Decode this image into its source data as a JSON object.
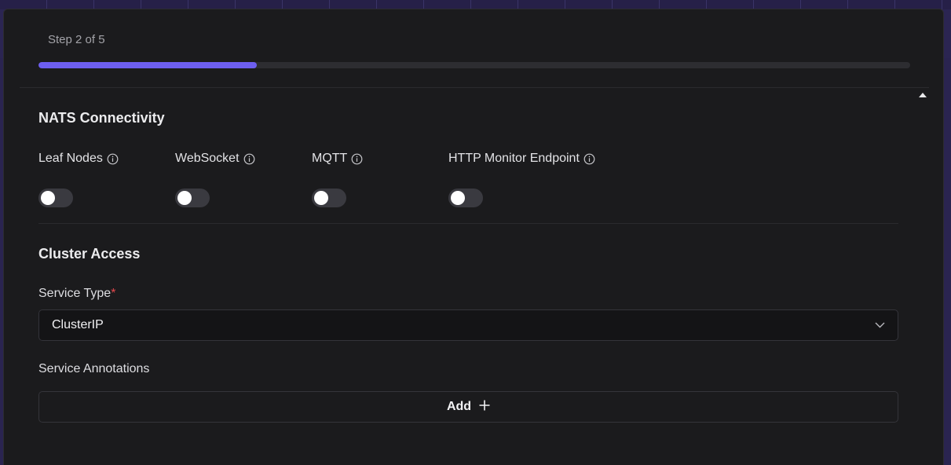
{
  "stepper": {
    "label": "Step 2 of 5",
    "progress_fraction": 0.25,
    "accent_color": "#6d5ef0"
  },
  "nats_connectivity": {
    "title": "NATS Connectivity",
    "toggles": [
      {
        "label": "Leaf Nodes",
        "enabled": false,
        "icon": "info-icon"
      },
      {
        "label": "WebSocket",
        "enabled": false,
        "icon": "info-icon"
      },
      {
        "label": "MQTT",
        "enabled": false,
        "icon": "info-icon"
      },
      {
        "label": "HTTP Monitor Endpoint",
        "enabled": false,
        "icon": "info-icon"
      }
    ]
  },
  "cluster_access": {
    "title": "Cluster Access",
    "service_type": {
      "label": "Service Type",
      "required_marker": "*",
      "value": "ClusterIP",
      "icon": "chevron-down-icon"
    },
    "service_annotations": {
      "label": "Service Annotations",
      "add_label": "Add",
      "icon": "plus-icon"
    }
  },
  "colors": {
    "required": "#e5484d",
    "background": "#1b1b1d"
  }
}
